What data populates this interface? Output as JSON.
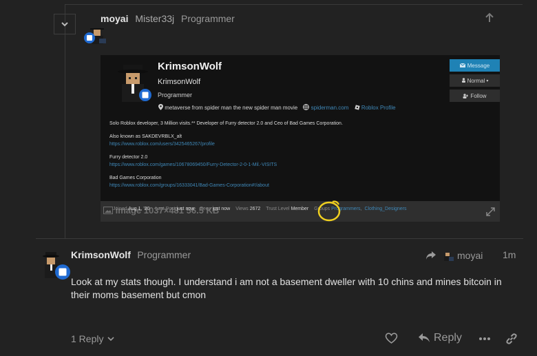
{
  "quoted_post": {
    "username": "moyai",
    "name": "Mister33j",
    "title": "Programmer",
    "profile": {
      "display_name": "KrimsonWolf",
      "username": "KrimsonWolf",
      "title": "Programmer",
      "location": "metaverse from spider man the new spider man movie",
      "website": "spiderman.com",
      "roblox_profile": "Roblox Profile",
      "buttons": {
        "message": "Message",
        "normal": "Normal",
        "follow": "Follow"
      },
      "bio": {
        "intro": "Solo Roblox developer, 3 Million visits.** Developer of Furry detector 2.0 and Ceo of Bad Games Corporation.",
        "alt_label": "Also known as SAKDEVRBLX_alt",
        "alt_link": "https://www.roblox.com/users/3425465267/profile",
        "furry_label": "Furry detector 2.0",
        "furry_link": "https://www.roblox.com/games/10678069450/Furry-Detector-2-0-1-Mil.-VISITS",
        "corp_label": "Bad Games Corporation",
        "corp_link": "https://www.roblox.com/groups/16333041/Bad-Games-Corporation#!/about"
      },
      "stats": {
        "image_overlay": "image 1037×481 56.5 KB",
        "joined_label": "Joined",
        "joined_value": "Aug 1, '20",
        "last_post_label": "Last Post",
        "last_post_value": "just now",
        "seen_label": "Seen",
        "seen_value": "just now",
        "views_label": "Views",
        "views_value": "2672",
        "trust_label": "Trust Level",
        "trust_value": "Member",
        "groups_label": "Groups",
        "group_1": "Programmers",
        "group_2": "Clothing_Designers"
      }
    }
  },
  "reply_post": {
    "username": "KrimsonWolf",
    "title": "Programmer",
    "reply_to": "moyai",
    "time": "1m",
    "body": "Look at my stats though. I understand i am not a basement dweller with 10 chins and mines bitcoin in their moms basement but cmon",
    "replies_label": "1 Reply",
    "reply_button": "Reply"
  },
  "colors": {
    "background": "#222222",
    "link": "#3f88b8",
    "highlight_circle": "#f0d020",
    "message_button": "#1f82b5"
  },
  "icons": [
    "chevron-down-icon",
    "arrow-up-icon",
    "map-pin-icon",
    "globe-icon",
    "roblox-icon",
    "envelope-icon",
    "user-plus-icon",
    "share-reply-icon",
    "heart-icon",
    "reply-icon",
    "more-icon",
    "link-icon",
    "expand-icon",
    "image-icon"
  ]
}
